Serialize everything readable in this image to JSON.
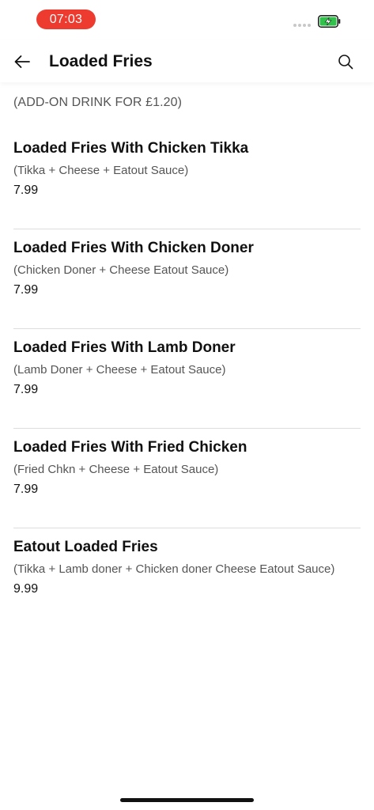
{
  "status_bar": {
    "time": "07:03",
    "accent_color": "#ee3b30",
    "battery_color": "#30c24a"
  },
  "header": {
    "title": "Loaded Fries",
    "back_icon": "arrow-left-icon",
    "search_icon": "search-icon"
  },
  "notice": "(ADD-ON DRINK FOR £1.20)",
  "items": [
    {
      "title": "Loaded Fries With Chicken Tikka",
      "description": "(Tikka + Cheese + Eatout Sauce)",
      "price": "7.99"
    },
    {
      "title": "Loaded Fries With Chicken Doner",
      "description": "(Chicken Doner + Cheese Eatout Sauce)",
      "price": "7.99"
    },
    {
      "title": "Loaded Fries With Lamb Doner",
      "description": "(Lamb Doner + Cheese + Eatout Sauce)",
      "price": "7.99"
    },
    {
      "title": "Loaded Fries With Fried Chicken",
      "description": "(Fried Chkn + Cheese + Eatout Sauce)",
      "price": "7.99"
    },
    {
      "title": "Eatout Loaded Fries",
      "description": "(Tikka + Lamb doner + Chicken doner Cheese Eatout Sauce)",
      "price": "9.99"
    }
  ]
}
